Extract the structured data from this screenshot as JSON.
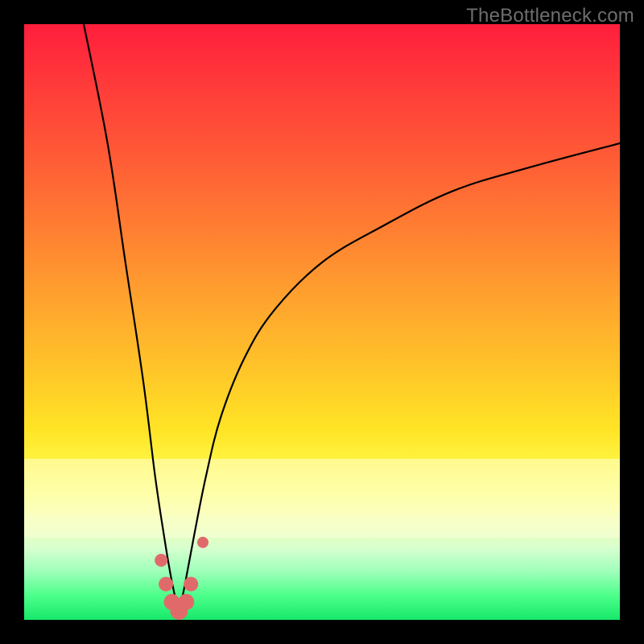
{
  "watermark": "TheBottleneck.com",
  "colors": {
    "frame_bg_top": "#ff1e3c",
    "frame_bg_bottom": "#17e86a",
    "curve": "#000000",
    "marker": "#e06a6a",
    "page_bg": "#000000",
    "watermark_text": "#6d6d6d"
  },
  "chart_data": {
    "type": "line",
    "title": "",
    "xlabel": "",
    "ylabel": "",
    "xlim": [
      0,
      100
    ],
    "ylim": [
      0,
      100
    ],
    "grid": false,
    "legend": false,
    "note": "Axis values estimated from pixel positions; y=0 at bottom of colored area, y=100 at top. Curve is a V-shaped bottleneck profile reaching ~0 near x≈26 then rising asymptotically toward ~80.",
    "series": [
      {
        "name": "left-branch",
        "x": [
          10,
          14,
          17,
          20,
          22,
          23.5,
          24.5,
          25.3,
          26
        ],
        "y": [
          100,
          80,
          60,
          40,
          24,
          14,
          8,
          4,
          1
        ]
      },
      {
        "name": "right-branch",
        "x": [
          26,
          27,
          28.5,
          30.5,
          33,
          37,
          42,
          50,
          60,
          72,
          85,
          100
        ],
        "y": [
          1,
          6,
          14,
          24,
          34,
          44,
          52,
          60,
          66,
          72,
          76,
          80
        ]
      }
    ],
    "markers": {
      "name": "highlighted-points",
      "color": "#e06a6a",
      "points": [
        {
          "x": 23.0,
          "y": 10,
          "r": 8
        },
        {
          "x": 23.8,
          "y": 6,
          "r": 9
        },
        {
          "x": 24.8,
          "y": 3,
          "r": 10
        },
        {
          "x": 26.0,
          "y": 1.5,
          "r": 11
        },
        {
          "x": 27.2,
          "y": 3,
          "r": 10
        },
        {
          "x": 28.0,
          "y": 6,
          "r": 9
        },
        {
          "x": 30.0,
          "y": 13,
          "r": 7
        }
      ]
    }
  }
}
